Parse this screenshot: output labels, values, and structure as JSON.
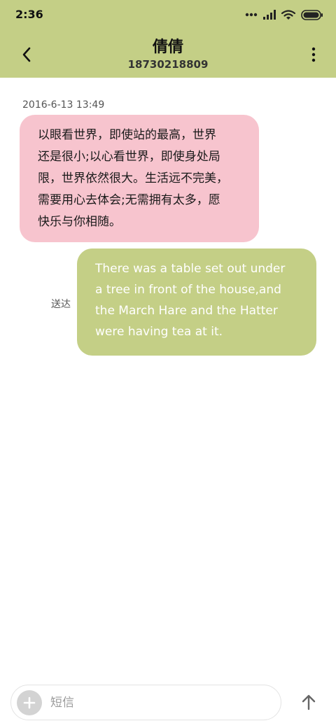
{
  "status_bar": {
    "time": "2:36",
    "icons": [
      "more-dots-icon",
      "signal-icon",
      "wifi-icon",
      "battery-icon"
    ]
  },
  "header": {
    "contact_name": "倩倩",
    "contact_number": "18730218809",
    "back_icon": "chevron-left-icon",
    "more_icon": "more-vertical-icon"
  },
  "conversation": {
    "timestamp": "2016-6-13 13:49",
    "messages": [
      {
        "direction": "incoming",
        "lines": [
          "以眼看世界，即使站的最高，世界",
          "还是很小;以心看世界，即使身处局",
          "限，世界依然很大。生活远不完美，",
          "需要用心去体会;无需拥有太多，愿",
          "快乐与你相随。"
        ]
      },
      {
        "direction": "outgoing",
        "status": "送达",
        "lines": [
          "There was a table set out under",
          "a tree in front of the house,and",
          "the March Hare and the Hatter",
          "were having tea at it."
        ]
      }
    ]
  },
  "composer": {
    "placeholder": "短信",
    "value": "",
    "attach_icon": "plus-icon",
    "send_icon": "arrow-up-icon"
  },
  "colors": {
    "header_bg": "#c4cf86",
    "incoming_bubble": "#f7c4ce",
    "outgoing_bubble": "#c4cf86",
    "outgoing_text": "#ffffff"
  }
}
